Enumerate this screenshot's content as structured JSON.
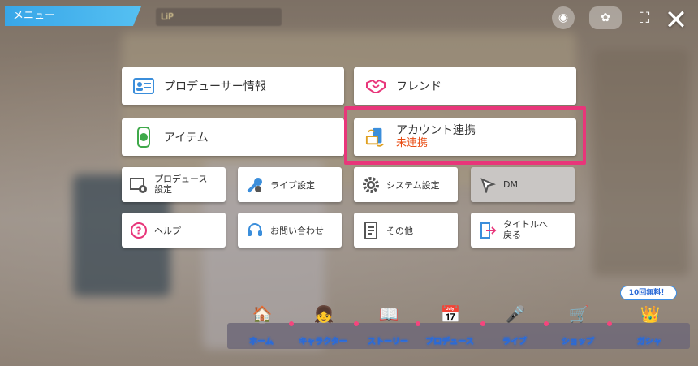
{
  "header": {
    "menu_title": "メニュー",
    "player_name": "LiP"
  },
  "menu": {
    "producer_info": "プロデューサー情報",
    "friend": "フレンド",
    "item": "アイテム",
    "account_link": "アカウント連携",
    "account_link_status": "未連携",
    "produce_settings_line1": "プロデュース",
    "produce_settings_line2": "設定",
    "live_settings": "ライブ設定",
    "system_settings": "システム設定",
    "dm": "DM",
    "help": "ヘルプ",
    "contact": "お問い合わせ",
    "other": "その他",
    "to_title_line1": "タイトルへ",
    "to_title_line2": "戻る"
  },
  "nav": {
    "home": "ホーム",
    "character": "キャラクター",
    "story": "ストーリー",
    "produce": "プロデュース",
    "live": "ライブ",
    "shop": "ショップ",
    "gacha": "ガシャ",
    "gacha_badge": "10回無料！"
  },
  "colors": {
    "accent": "#e8367a",
    "header_blue": "#38a6e8",
    "status_red": "#e84b12"
  }
}
